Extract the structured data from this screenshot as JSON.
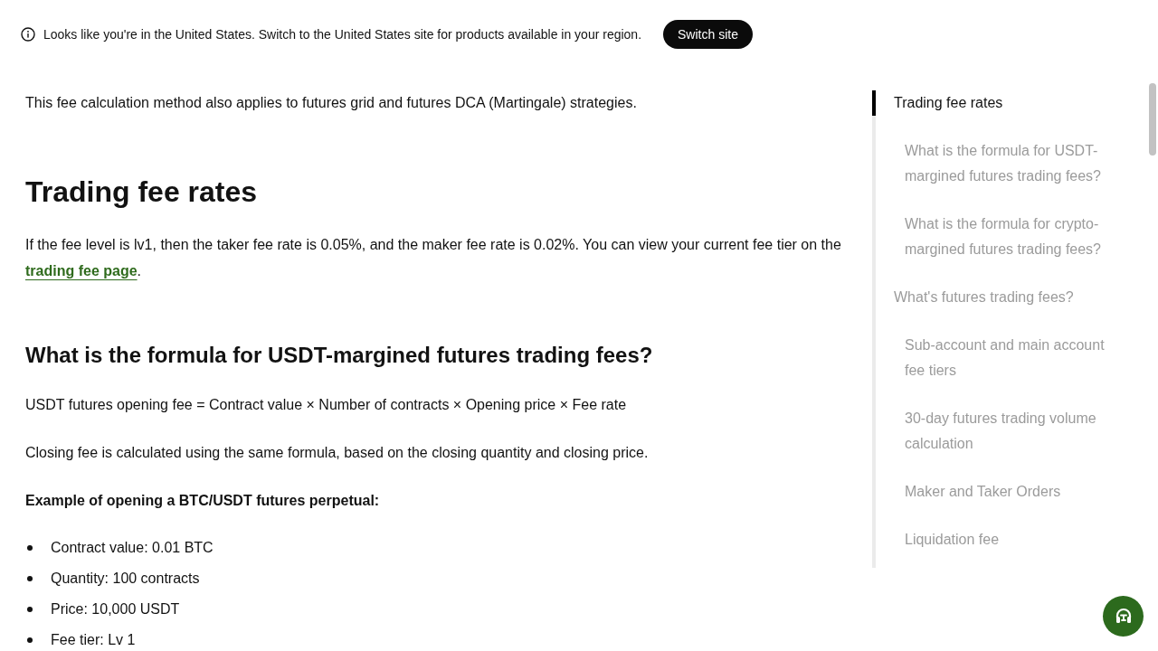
{
  "banner": {
    "message": "Looks like you're in the United States. Switch to the United States site for products available in your region.",
    "button": "Switch site"
  },
  "article": [
    {
      "kind": "paragraph",
      "text": "This fee calculation method also applies to futures grid and futures DCA (Martingale) strategies."
    },
    {
      "kind": "heading",
      "text": "Trading fee rates"
    },
    {
      "kind": "paragraph",
      "text": "If the fee level is lv1, then the taker fee rate is 0.05%, and the maker fee rate is 0.02%. You can view your current fee tier on the",
      "link": "trading fee page",
      "after": "."
    },
    {
      "kind": "subheading",
      "text": "What is the formula for USDT-margined futures trading fees?"
    },
    {
      "kind": "paragraph",
      "text": "USDT futures opening fee = Contract value × Number of contracts × Opening price × Fee rate"
    },
    {
      "kind": "paragraph",
      "text": "Closing fee is calculated using the same formula, based on the closing quantity and closing price."
    },
    {
      "kind": "label",
      "text": "Example of opening a BTC/USDT futures perpetual:"
    },
    {
      "kind": "bullets",
      "items": [
        "Contract value: 0.01 BTC",
        "Quantity: 100 contracts",
        "Price: 10,000 USDT",
        "Fee tier: Lv 1"
      ]
    }
  ],
  "toc": [
    {
      "label": "Trading fee rates",
      "selected": true,
      "children": [
        {
          "label": "What is the formula for USDT-margined futures trading fees?",
          "selected": false
        },
        {
          "label": "What is the formula for crypto-margined futures trading fees?",
          "selected": false
        }
      ]
    },
    {
      "label": "What's futures trading fees?",
      "selected": false,
      "children": [
        {
          "label": "Sub-account and main account fee tiers",
          "selected": false
        },
        {
          "label": "30-day futures trading volume calculation",
          "selected": false
        },
        {
          "label": "Maker and Taker Orders",
          "selected": false
        },
        {
          "label": "Liquidation fee",
          "selected": false
        }
      ]
    }
  ]
}
